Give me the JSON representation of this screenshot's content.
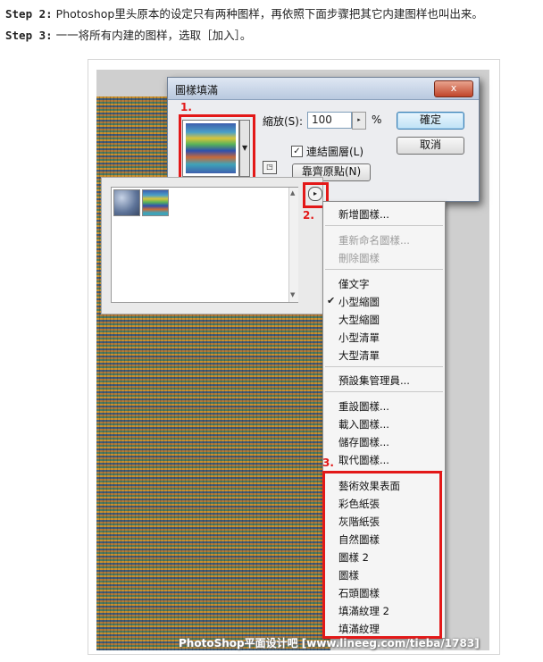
{
  "steps": [
    {
      "label": "Step 2:",
      "text": "Photoshop里头原本的设定只有两种图样，再依照下面步骤把其它内建图样也叫出来。"
    },
    {
      "label": "Step 3:",
      "text": "一一将所有内建的图样，选取［加入］。"
    }
  ],
  "dialog": {
    "title": "圖樣填滿",
    "close_label": "x",
    "scale_label": "縮放(S):",
    "scale_value": "100",
    "percent": "%",
    "ok_label": "確定",
    "cancel_label": "取消",
    "link_layer_label": "連結圖層(L)",
    "link_layer_checked": true,
    "snap_origin_label": "靠齊原點(N)"
  },
  "annotations": {
    "step1": "1.",
    "step2": "2.",
    "step3": "3."
  },
  "menu": {
    "items": [
      {
        "label": "新增圖樣...",
        "disabled": false,
        "checked": false
      },
      {
        "label": "重新命名圖樣...",
        "disabled": true,
        "checked": false
      },
      {
        "label": "刪除圖樣",
        "disabled": true,
        "checked": false
      },
      {
        "label": "僅文字",
        "disabled": false,
        "checked": false
      },
      {
        "label": "小型縮圖",
        "disabled": false,
        "checked": true
      },
      {
        "label": "大型縮圖",
        "disabled": false,
        "checked": false
      },
      {
        "label": "小型清單",
        "disabled": false,
        "checked": false
      },
      {
        "label": "大型清單",
        "disabled": false,
        "checked": false
      },
      {
        "label": "預設集管理員...",
        "disabled": false,
        "checked": false
      },
      {
        "label": "重設圖樣...",
        "disabled": false,
        "checked": false
      },
      {
        "label": "載入圖樣...",
        "disabled": false,
        "checked": false
      },
      {
        "label": "儲存圖樣...",
        "disabled": false,
        "checked": false
      },
      {
        "label": "取代圖樣...",
        "disabled": false,
        "checked": false
      },
      {
        "label": "藝術效果表面",
        "disabled": false,
        "checked": false
      },
      {
        "label": "彩色紙張",
        "disabled": false,
        "checked": false
      },
      {
        "label": "灰階紙張",
        "disabled": false,
        "checked": false
      },
      {
        "label": "自然圖樣",
        "disabled": false,
        "checked": false
      },
      {
        "label": "圖樣 2",
        "disabled": false,
        "checked": false
      },
      {
        "label": "圖樣",
        "disabled": false,
        "checked": false
      },
      {
        "label": "石頭圖樣",
        "disabled": false,
        "checked": false
      },
      {
        "label": "填滿紋理 2",
        "disabled": false,
        "checked": false
      },
      {
        "label": "填滿紋理",
        "disabled": false,
        "checked": false
      }
    ]
  },
  "watermark": "PhotoShop平面设计吧 [www.lineeg.com/tieba/1783]",
  "colors": {
    "highlight": "#e31818",
    "accent": "#3c7fb1"
  }
}
